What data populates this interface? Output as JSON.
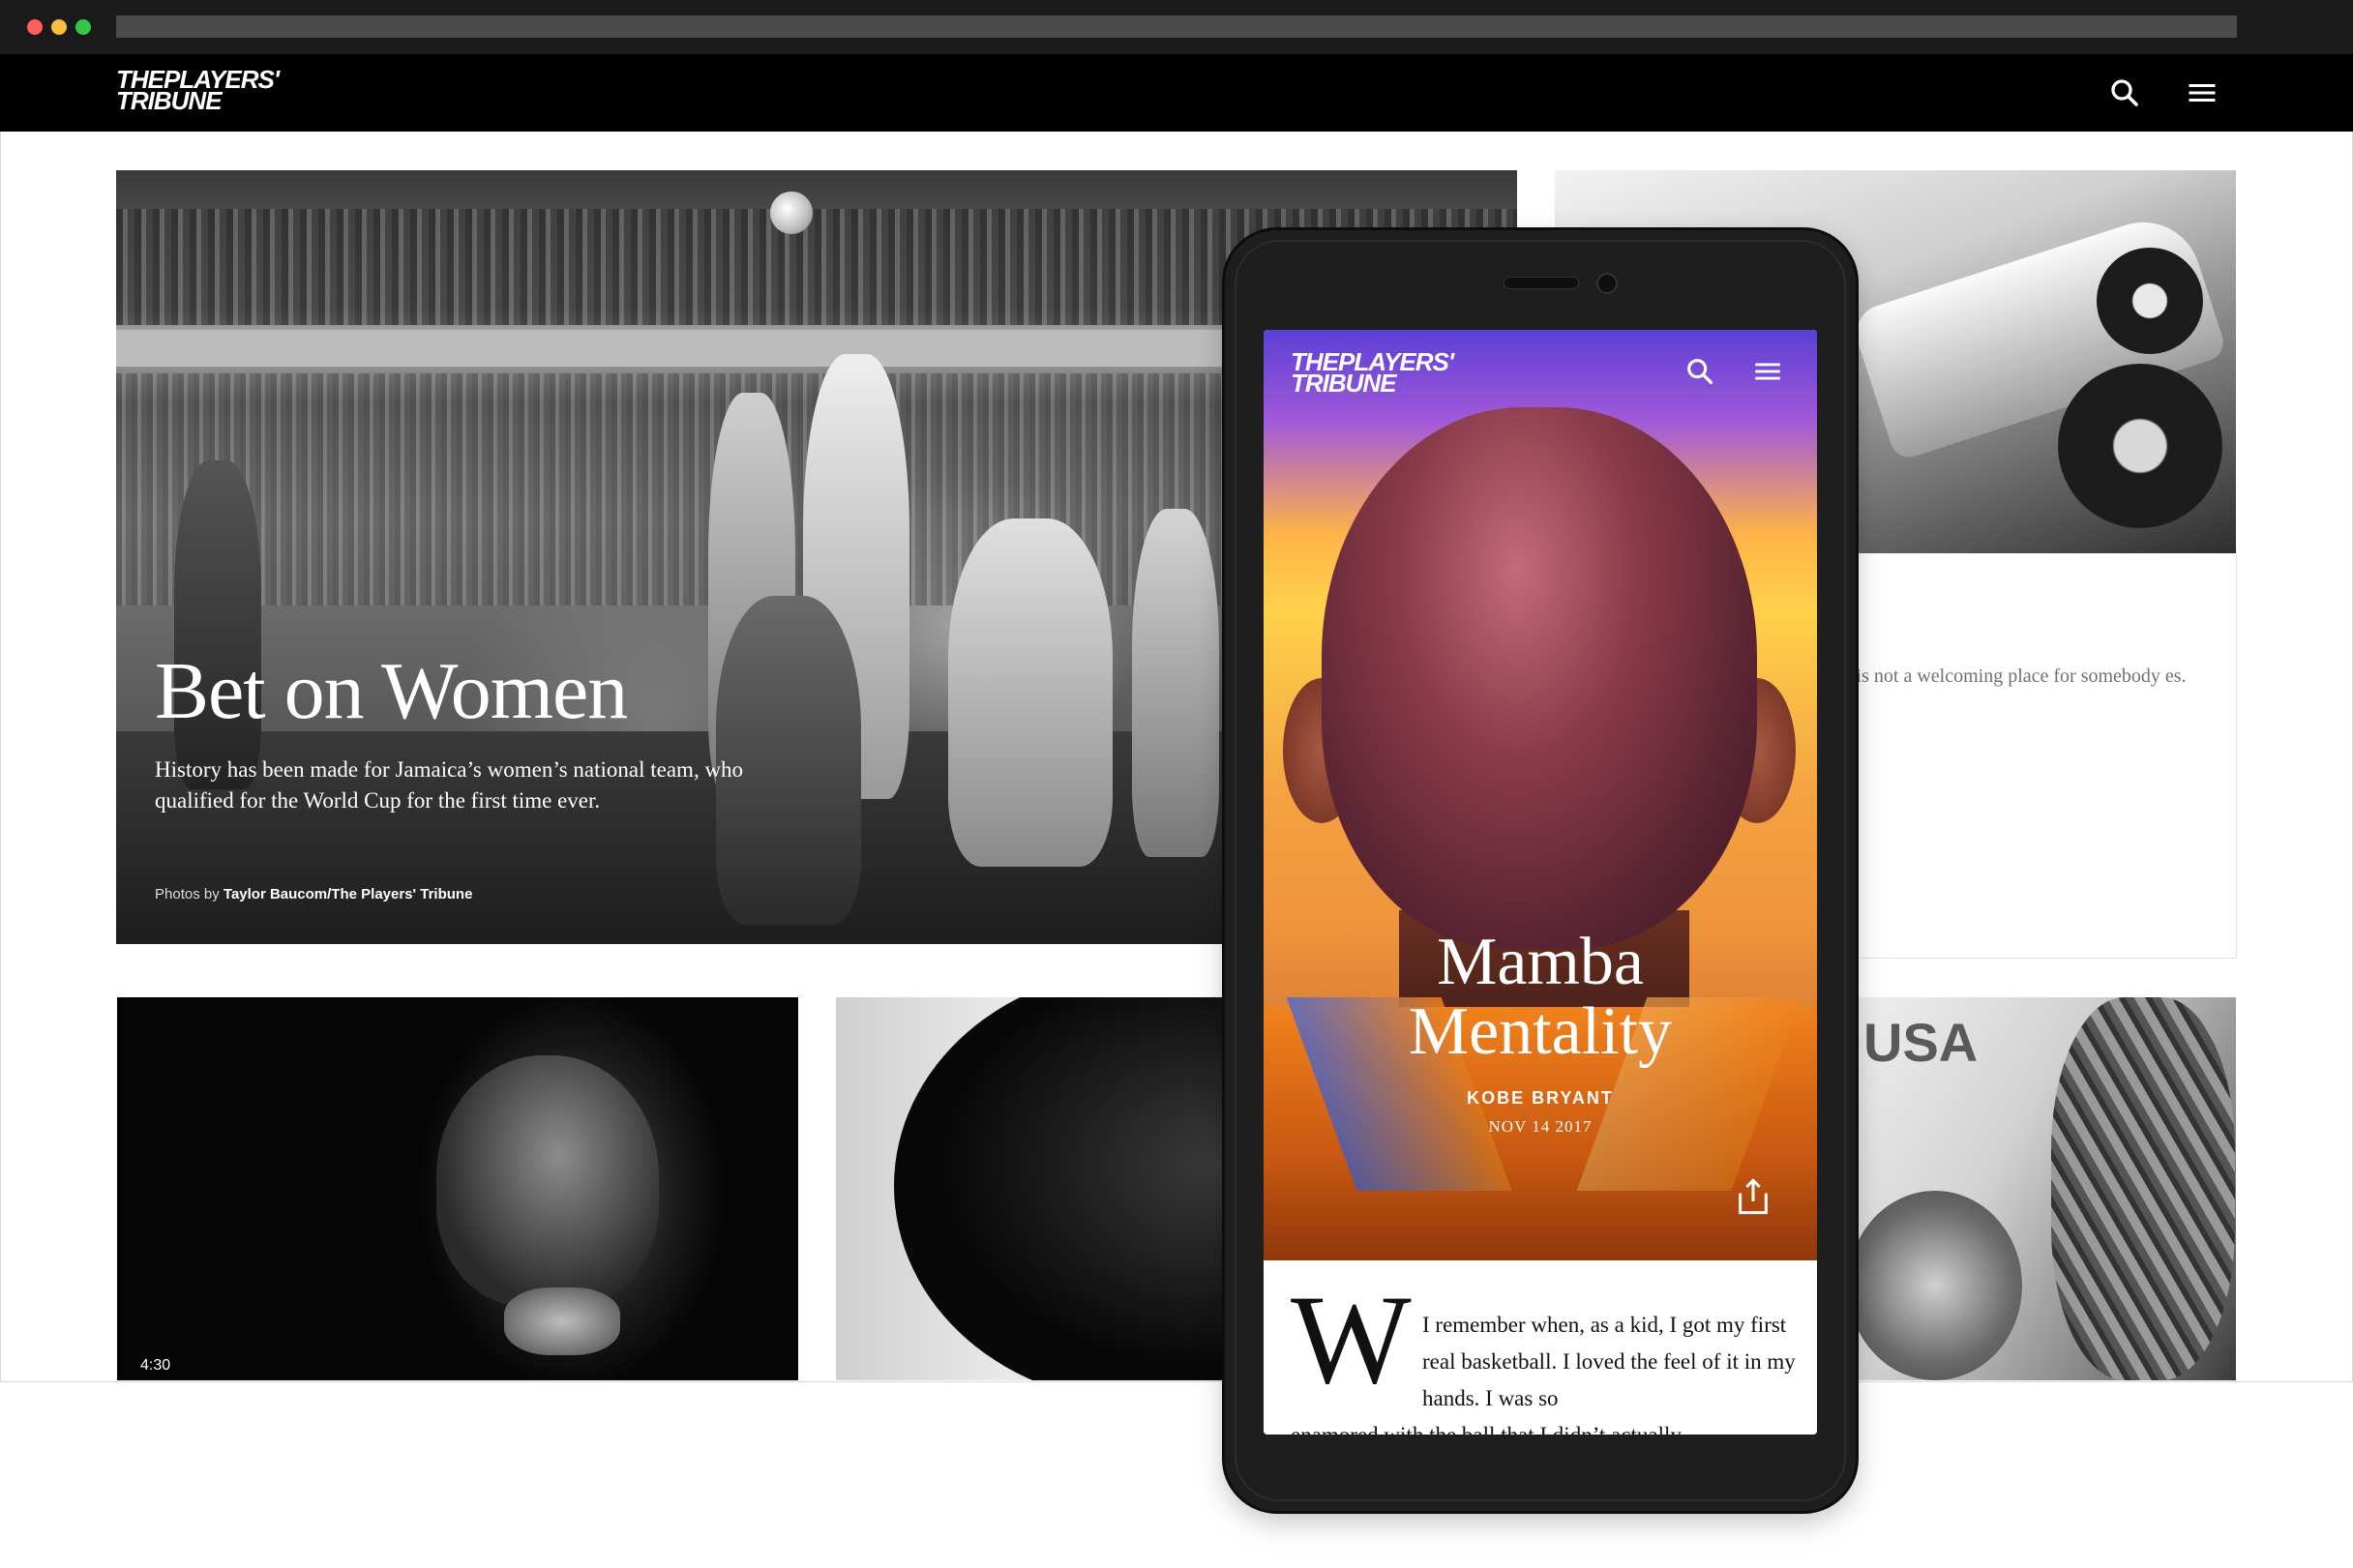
{
  "site": {
    "logo_line1": "THEPLAYERS'",
    "logo_line2": "TRIBUNE",
    "icons": [
      "search-icon",
      "menu-icon"
    ]
  },
  "hero": {
    "title": "Bet on Women",
    "subtitle": "History has been made for Jamaica’s women’s national team, who qualified for the World Cup for the first time ever.",
    "credit_prefix": "Photos by",
    "credit_name": "Taylor Baucom/The Players' Tribune"
  },
  "side_card": {
    "excerpt": "t is not a welcoming place for somebody es."
  },
  "bottom_cards": {
    "video_duration": "4:30",
    "jersey_text": "USA"
  },
  "mobile": {
    "logo_line1": "THEPLAYERS'",
    "logo_line2": "TRIBUNE",
    "title_line1": "Mamba",
    "title_line2": "Mentality",
    "author": "KOBE BRYANT",
    "date": "NOV 14 2017",
    "dropcap": "W",
    "body_line1": "I remember when, as a kid, I got my first real basketball. I loved the feel of it in my hands. I was so",
    "body_line2": "enamored with the ball that I didn’t actually"
  },
  "colors": {
    "chrome_bg": "#1a1a1a",
    "dot_red": "#fc605b",
    "dot_yellow": "#fdbc40",
    "dot_green": "#34c84a",
    "header_bg": "#000000",
    "mobile_gradient_top": "#5b3fd6",
    "mobile_gradient_bottom": "#f26a14"
  }
}
